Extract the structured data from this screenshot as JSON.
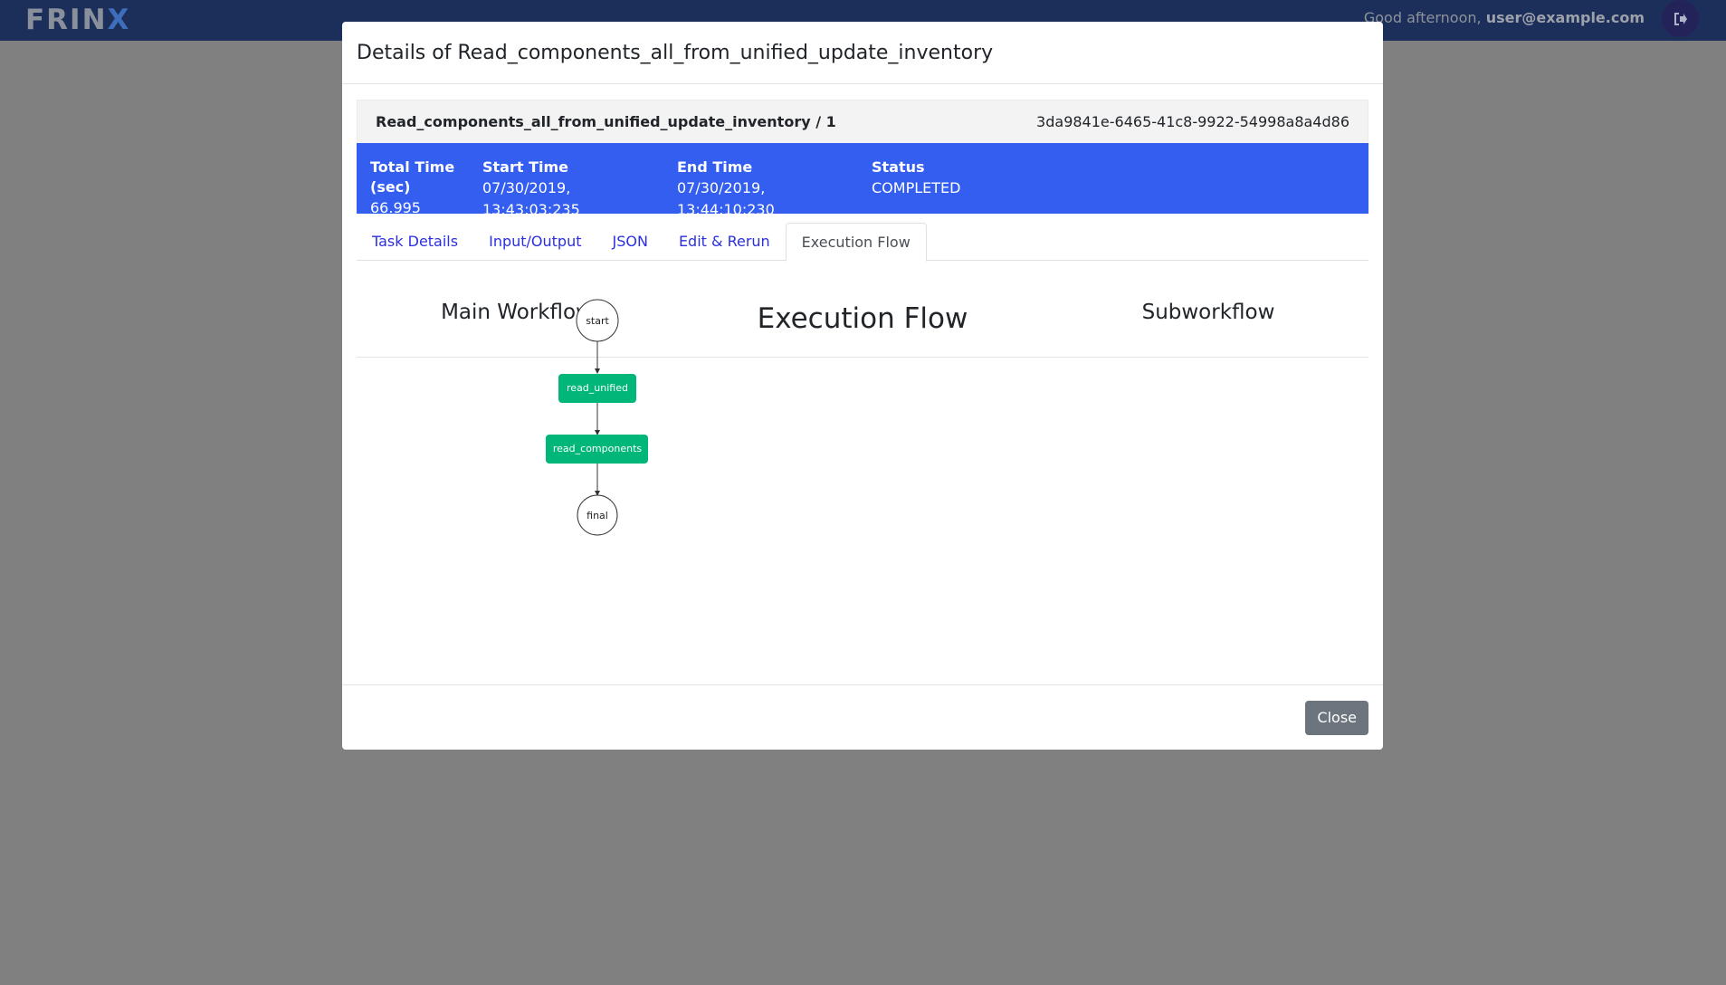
{
  "header": {
    "logo_main": "FRIN",
    "logo_accent": "X",
    "greeting_prefix": "Good afternoon,",
    "user_email": "user@example.com",
    "logout_icon": "sign-out-icon"
  },
  "modal": {
    "title": "Details of Read_components_all_from_unified_update_inventory",
    "workflow_name": "Read_components_all_from_unified_update_inventory / 1",
    "workflow_id": "3da9841e-6465-41c8-9922-54998a8a4d86",
    "stats": [
      {
        "label": "Total Time (sec)",
        "value": "66.995"
      },
      {
        "label": "Start Time",
        "value": "07/30/2019, 13:43:03:235"
      },
      {
        "label": "End Time",
        "value": "07/30/2019, 13:44:10:230"
      },
      {
        "label": "Status",
        "value": "COMPLETED"
      }
    ],
    "tabs": [
      {
        "label": "Task Details",
        "active": false
      },
      {
        "label": "Input/Output",
        "active": false
      },
      {
        "label": "JSON",
        "active": false
      },
      {
        "label": "Edit & Rerun",
        "active": false
      },
      {
        "label": "Execution Flow",
        "active": true
      }
    ],
    "flow": {
      "main_heading": "Main Workflow",
      "center_heading": "Execution Flow",
      "sub_heading": "Subworkflow",
      "nodes": [
        {
          "label": "start",
          "kind": "terminal"
        },
        {
          "label": "read_unified",
          "kind": "task",
          "color": "#00b679"
        },
        {
          "label": "read_components",
          "kind": "task",
          "color": "#00b679"
        },
        {
          "label": "final",
          "kind": "terminal"
        }
      ]
    },
    "close_label": "Close"
  },
  "colors": {
    "topbar": "#1c2f5b",
    "info_bar": "#335ef0",
    "task_node": "#00b679",
    "tab_link": "#2b2fe0"
  }
}
